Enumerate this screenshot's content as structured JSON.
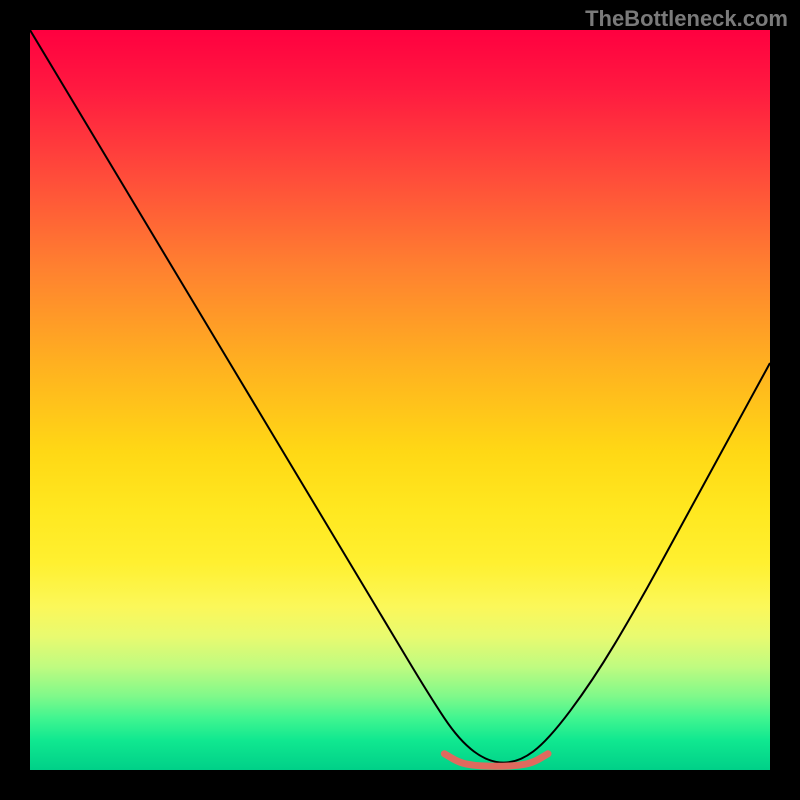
{
  "watermark": "TheBottleneck.com",
  "chart_data": {
    "type": "line",
    "title": "",
    "xlabel": "",
    "ylabel": "",
    "xlim": [
      0,
      100
    ],
    "ylim": [
      0,
      100
    ],
    "grid": false,
    "legend": false,
    "background_gradient": {
      "type": "vertical",
      "stops": [
        {
          "pos": 0.0,
          "color": "#ff0040"
        },
        {
          "pos": 0.2,
          "color": "#ff4d3a"
        },
        {
          "pos": 0.45,
          "color": "#ffb020"
        },
        {
          "pos": 0.65,
          "color": "#ffe820"
        },
        {
          "pos": 0.82,
          "color": "#e8fa70"
        },
        {
          "pos": 0.93,
          "color": "#40f590"
        },
        {
          "pos": 1.0,
          "color": "#00d088"
        }
      ]
    },
    "series": [
      {
        "name": "main-curve",
        "color": "#000000",
        "stroke_width": 2,
        "x": [
          0,
          6,
          12,
          18,
          24,
          30,
          36,
          42,
          48,
          54,
          58,
          62,
          66,
          70,
          76,
          82,
          88,
          94,
          100
        ],
        "y": [
          100,
          90,
          80,
          70,
          60,
          50,
          40,
          30,
          20,
          10,
          4,
          1,
          1,
          4,
          12,
          22,
          33,
          44,
          55
        ]
      },
      {
        "name": "bottom-marker",
        "color": "#e06a5e",
        "stroke_width": 7,
        "linecap": "round",
        "x": [
          56,
          58,
          60,
          62,
          64,
          66,
          68,
          70
        ],
        "y": [
          2.2,
          1.0,
          0.6,
          0.5,
          0.5,
          0.6,
          1.0,
          2.2
        ]
      }
    ]
  }
}
